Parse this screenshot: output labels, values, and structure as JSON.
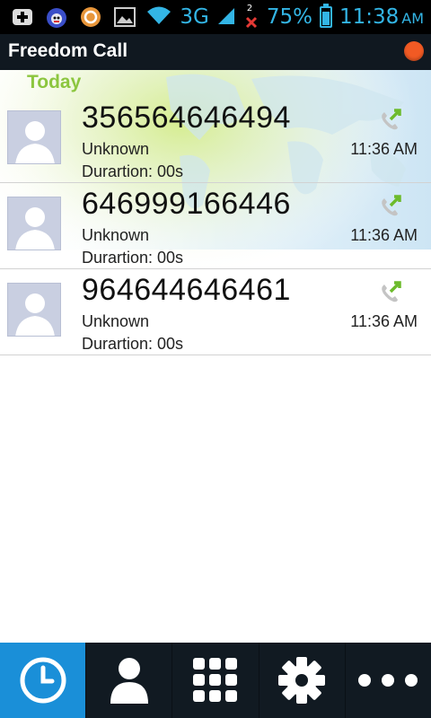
{
  "status_bar": {
    "network": "3G",
    "notification_count": "2",
    "battery": "75%",
    "battery_level": 0.75,
    "time": "11:38",
    "ampm": "AM",
    "icons": [
      "plus-notification-icon",
      "cat-app-icon",
      "orange-app-icon",
      "image-icon",
      "wifi-icon",
      "signal-icon",
      "no-signal-icon",
      "battery-icon"
    ]
  },
  "app": {
    "title": "Freedom Call",
    "record_indicator_color": "#f15a24"
  },
  "section": {
    "label": "Today"
  },
  "calls": [
    {
      "number": "356564646494",
      "name": "Unknown",
      "duration": "Durartion: 00s",
      "time": "11:36 AM",
      "icon": "outgoing-call-icon"
    },
    {
      "number": "646999166446",
      "name": "Unknown",
      "duration": "Durartion: 00s",
      "time": "11:36 AM",
      "icon": "outgoing-call-icon"
    },
    {
      "number": "964644646461",
      "name": "Unknown",
      "duration": "Durartion: 00s",
      "time": "11:36 AM",
      "icon": "outgoing-call-icon"
    }
  ],
  "bottom_nav": {
    "items": [
      {
        "icon": "clock-icon",
        "active": true
      },
      {
        "icon": "contact-icon",
        "active": false
      },
      {
        "icon": "dialpad-icon",
        "active": false
      },
      {
        "icon": "gear-icon",
        "active": false
      },
      {
        "icon": "more-icon",
        "active": false
      }
    ],
    "active_color": "#1a8fd8"
  }
}
